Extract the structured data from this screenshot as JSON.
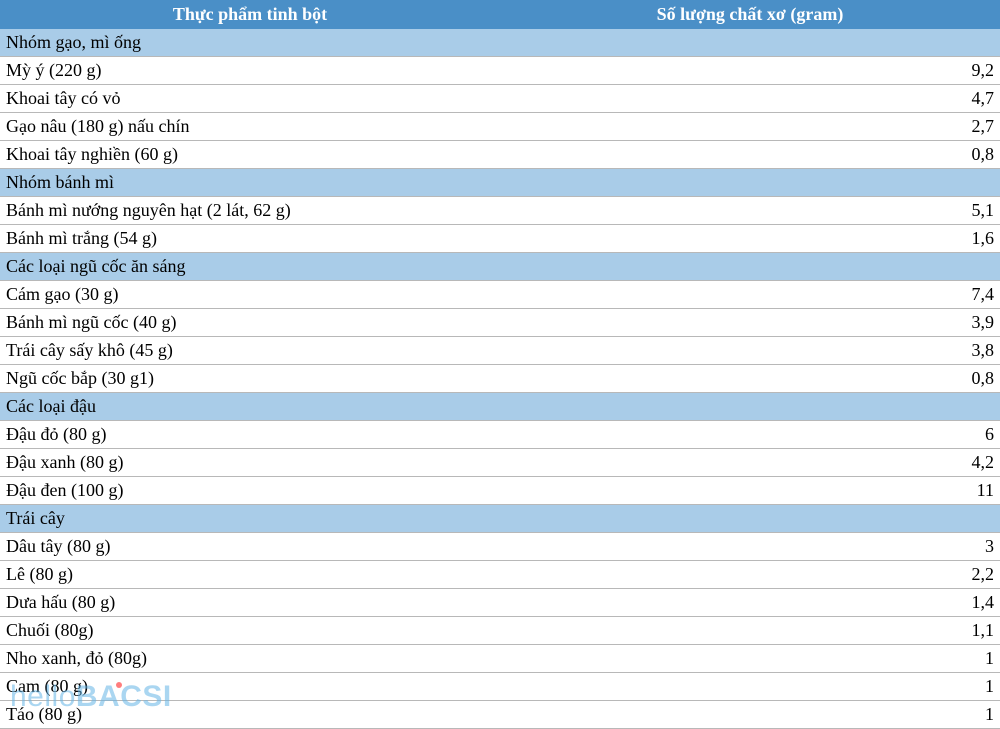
{
  "header": {
    "col1": "Thực phẩm tinh bột",
    "col2": "Số lượng chất xơ (gram)"
  },
  "groups": [
    {
      "name": "Nhóm gạo, mì ống",
      "items": [
        {
          "food": "Mỳ ý (220 g)",
          "fiber": "9,2"
        },
        {
          "food": "Khoai tây có vỏ",
          "fiber": "4,7"
        },
        {
          "food": "Gạo nâu (180 g) nấu chín",
          "fiber": "2,7"
        },
        {
          "food": "Khoai tây nghiền (60 g)",
          "fiber": "0,8"
        }
      ]
    },
    {
      "name": "Nhóm bánh mì",
      "items": [
        {
          "food": "Bánh mì nướng nguyên hạt (2 lát, 62 g)",
          "fiber": "5,1"
        },
        {
          "food": "Bánh mì trắng (54 g)",
          "fiber": "1,6"
        }
      ]
    },
    {
      "name": "Các loại ngũ cốc ăn sáng",
      "items": [
        {
          "food": "Cám gạo (30 g)",
          "fiber": "7,4"
        },
        {
          "food": "Bánh mì ngũ cốc (40 g)",
          "fiber": "3,9"
        },
        {
          "food": "Trái cây sấy khô (45 g)",
          "fiber": "3,8"
        },
        {
          "food": "Ngũ cốc bắp (30 g1)",
          "fiber": "0,8"
        }
      ]
    },
    {
      "name": "Các loại đậu",
      "items": [
        {
          "food": "Đậu đỏ (80 g)",
          "fiber": "6"
        },
        {
          "food": "Đậu xanh (80 g)",
          "fiber": "4,2"
        },
        {
          "food": "Đậu đen (100 g)",
          "fiber": "11"
        }
      ]
    },
    {
      "name": "Trái cây",
      "items": [
        {
          "food": "Dâu tây (80 g)",
          "fiber": "3"
        },
        {
          "food": "Lê (80 g)",
          "fiber": "2,2"
        },
        {
          "food": "Dưa hấu (80 g)",
          "fiber": "1,4"
        },
        {
          "food": "Chuối (80g)",
          "fiber": "1,1"
        },
        {
          "food": "Nho xanh, đỏ (80g)",
          "fiber": "1"
        },
        {
          "food": "Cam (80 g)",
          "fiber": "1"
        },
        {
          "food": "Táo (80 g)",
          "fiber": "1"
        }
      ]
    }
  ],
  "watermark": {
    "hello": "hello",
    "bacsi": "BACSI"
  }
}
